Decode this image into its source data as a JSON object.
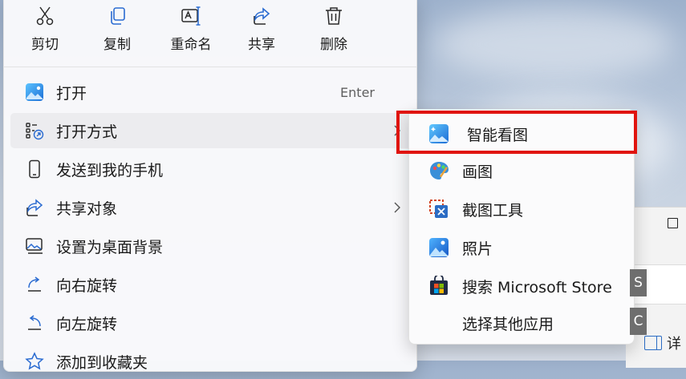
{
  "quick_actions": [
    {
      "label": "剪切",
      "icon": "scissors-icon"
    },
    {
      "label": "复制",
      "icon": "copy-icon"
    },
    {
      "label": "重命名",
      "icon": "rename-icon"
    },
    {
      "label": "共享",
      "icon": "share-icon"
    },
    {
      "label": "删除",
      "icon": "trash-icon"
    }
  ],
  "menu_items": [
    {
      "label": "打开",
      "shortcut": "Enter",
      "icon": "photos-icon"
    },
    {
      "label": "打开方式",
      "icon": "open-with-icon",
      "has_submenu": true
    },
    {
      "label": "发送到我的手机",
      "icon": "phone-icon"
    },
    {
      "label": "共享对象",
      "icon": "share-icon",
      "has_submenu": true
    },
    {
      "label": "设置为桌面背景",
      "icon": "desktop-background-icon"
    },
    {
      "label": "向右旋转",
      "icon": "rotate-right-icon"
    },
    {
      "label": "向左旋转",
      "icon": "rotate-left-icon"
    },
    {
      "label": "添加到收藏夹",
      "icon": "star-icon"
    }
  ],
  "submenu_items": [
    {
      "label": "智能看图",
      "icon": "smart-viewer-icon"
    },
    {
      "label": "画图",
      "icon": "paint-icon"
    },
    {
      "label": "截图工具",
      "icon": "snipping-tool-icon"
    },
    {
      "label": "照片",
      "icon": "photos-icon"
    },
    {
      "label": "搜索 Microsoft Store",
      "icon": "store-icon"
    },
    {
      "label": "选择其他应用",
      "icon": ""
    }
  ],
  "background": {
    "access_keys": [
      "S",
      "C"
    ],
    "detail_label": "详"
  },
  "colors": {
    "highlight_border": "#e0140f",
    "accent": "#2b6cc4"
  }
}
